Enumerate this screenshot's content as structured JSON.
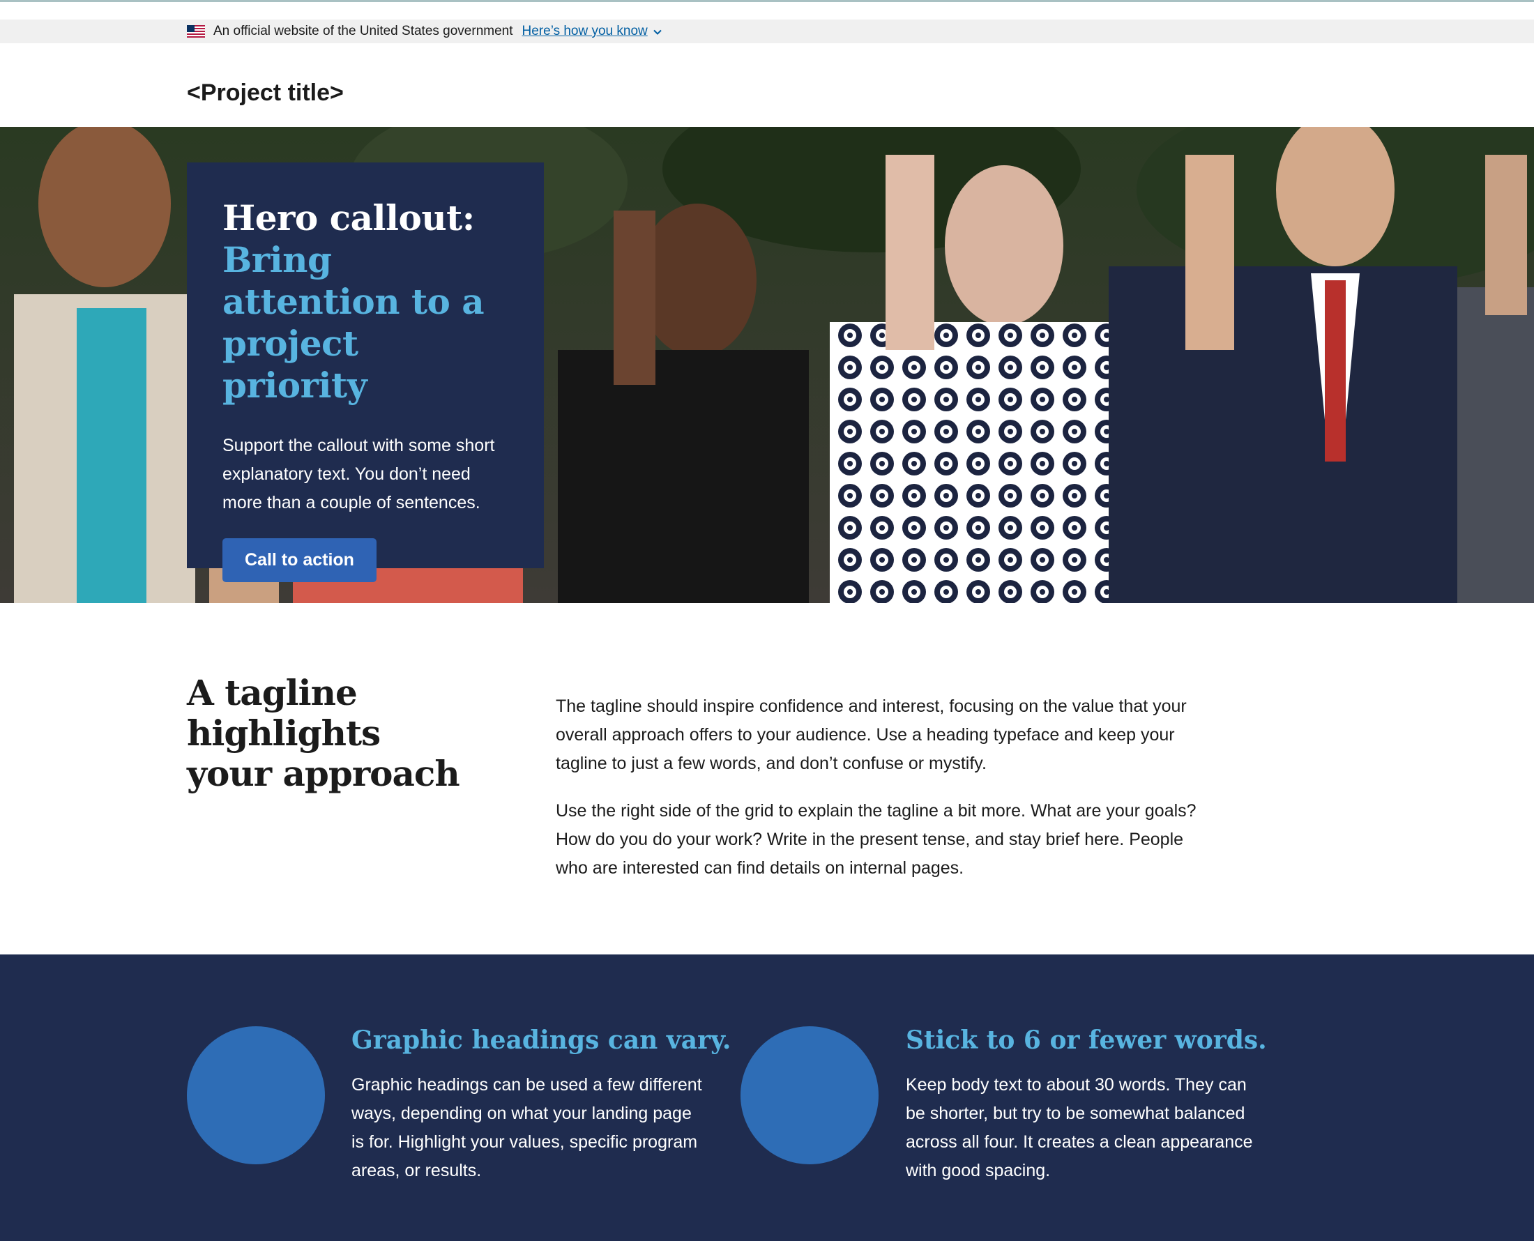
{
  "banner": {
    "official_text": "An official website of the United States government",
    "how_link": "Here’s how you know"
  },
  "header": {
    "project_title": "<Project title>"
  },
  "hero": {
    "heading_lead": "Hero callout:",
    "heading_accent": "Bring attention to a project priority",
    "body": "Support the callout with some short explanatory text. You don’t need more than a couple of sentences.",
    "cta_label": "Call to action"
  },
  "tagline": {
    "heading": "A tagline highlights your approach",
    "paragraphs": [
      "The tagline should inspire confidence and interest, focusing on the value that your overall approach offers to your audience. Use a heading typeface and keep your tagline to just a few words, and don’t confuse or mystify.",
      "Use the right side of the grid to explain the tagline a bit more. What are your goals? How do you do your work? Write in the present tense, and stay brief here. People who are interested can find details on internal pages."
    ]
  },
  "graphics": [
    {
      "heading": "Graphic headings can vary.",
      "text": "Graphic headings can be used a few different ways, depending on what your landing page is for. Highlight your values, specific program areas, or results."
    },
    {
      "heading": "Stick to 6 or fewer words.",
      "text": "Keep body text to about 30 words. They can be shorter, but try to be somewhat balanced across all four. It creates a clean appearance with good spacing."
    }
  ],
  "colors": {
    "navy": "#1f2c4f",
    "accent_cyan": "#58b4e0",
    "primary_blue": "#2f63b4",
    "circle_blue": "#2e6db6",
    "link_blue": "#005ea2"
  },
  "icons": {
    "flag": "us-flag-icon",
    "chevron": "chevron-down-icon"
  }
}
